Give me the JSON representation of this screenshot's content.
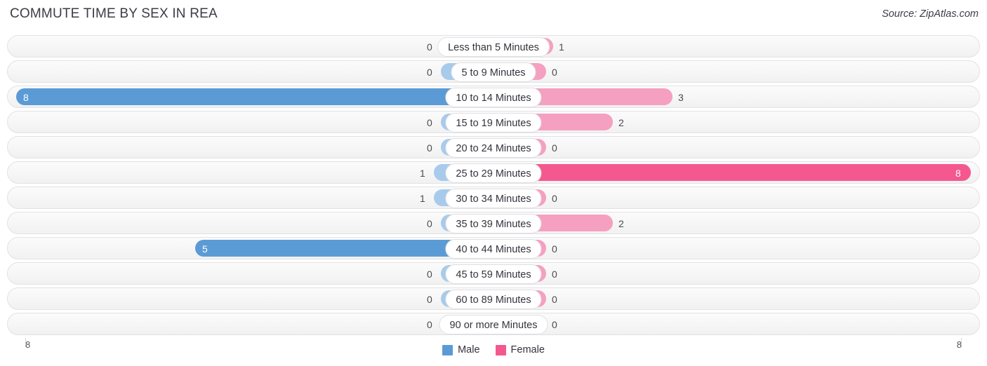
{
  "header": {
    "title": "COMMUTE TIME BY SEX IN REA",
    "source": "Source: ZipAtlas.com"
  },
  "legend": {
    "male_label": "Male",
    "female_label": "Female"
  },
  "axis": {
    "left_tick": "8",
    "right_tick": "8"
  },
  "colors": {
    "male_dark": "#5b9bd5",
    "male_light": "#a8cbec",
    "female_dark": "#f4588f",
    "female_light": "#f5a0c0",
    "row_bg": "#f6f6f6",
    "row_border": "#e2e2e4",
    "text": "#3c3c46"
  },
  "chart_data": {
    "type": "bar",
    "orientation": "horizontal-diverging",
    "title": "COMMUTE TIME BY SEX IN REA",
    "xlabel": "",
    "ylabel": "",
    "axis_max": 8,
    "xlim": [
      8,
      8
    ],
    "grid": false,
    "legend_position": "bottom-center",
    "categories": [
      "Less than 5 Minutes",
      "5 to 9 Minutes",
      "10 to 14 Minutes",
      "15 to 19 Minutes",
      "20 to 24 Minutes",
      "25 to 29 Minutes",
      "30 to 34 Minutes",
      "35 to 39 Minutes",
      "40 to 44 Minutes",
      "45 to 59 Minutes",
      "60 to 89 Minutes",
      "90 or more Minutes"
    ],
    "series": [
      {
        "name": "Male",
        "values": [
          0,
          0,
          8,
          0,
          0,
          1,
          1,
          0,
          5,
          0,
          0,
          0
        ]
      },
      {
        "name": "Female",
        "values": [
          1,
          0,
          3,
          2,
          0,
          8,
          0,
          2,
          0,
          0,
          0,
          0
        ]
      }
    ]
  },
  "rows": [
    {
      "label": "Less than 5 Minutes",
      "male": "0",
      "female": "1"
    },
    {
      "label": "5 to 9 Minutes",
      "male": "0",
      "female": "0"
    },
    {
      "label": "10 to 14 Minutes",
      "male": "8",
      "female": "3"
    },
    {
      "label": "15 to 19 Minutes",
      "male": "0",
      "female": "2"
    },
    {
      "label": "20 to 24 Minutes",
      "male": "0",
      "female": "0"
    },
    {
      "label": "25 to 29 Minutes",
      "male": "1",
      "female": "8"
    },
    {
      "label": "30 to 34 Minutes",
      "male": "1",
      "female": "0"
    },
    {
      "label": "35 to 39 Minutes",
      "male": "0",
      "female": "2"
    },
    {
      "label": "40 to 44 Minutes",
      "male": "5",
      "female": "0"
    },
    {
      "label": "45 to 59 Minutes",
      "male": "0",
      "female": "0"
    },
    {
      "label": "60 to 89 Minutes",
      "male": "0",
      "female": "0"
    },
    {
      "label": "90 or more Minutes",
      "male": "0",
      "female": "0"
    }
  ]
}
